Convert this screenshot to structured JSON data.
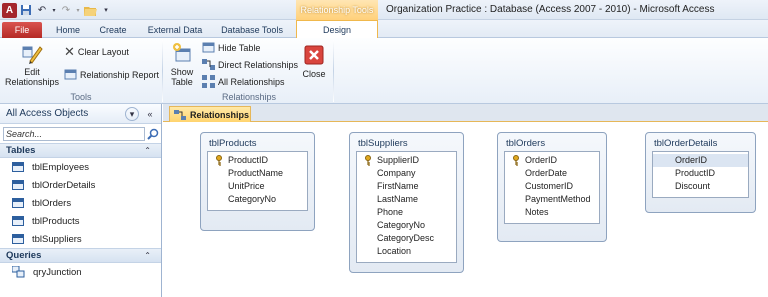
{
  "window": {
    "title": "Organization Practice : Database (Access 2007 - 2010)  -  Microsoft Access",
    "context_tools_label": "Relationship Tools"
  },
  "quick_access": {
    "app_logo": "A",
    "icons": [
      "save-icon",
      "undo-icon",
      "redo-icon",
      "open-folder-icon",
      "customize-dropdown-icon"
    ]
  },
  "tabs": [
    {
      "label": "File"
    },
    {
      "label": "Home"
    },
    {
      "label": "Create"
    },
    {
      "label": "External Data"
    },
    {
      "label": "Database Tools"
    },
    {
      "label": "Design"
    }
  ],
  "ribbon": {
    "edit_relationships": "Edit Relationships",
    "clear_layout": "Clear Layout",
    "relationship_report": "Relationship Report",
    "tools_group": "Tools",
    "show_table": "Show Table",
    "hide_table": "Hide Table",
    "direct_relationships": "Direct Relationships",
    "all_relationships": "All Relationships",
    "close": "Close",
    "relationships_group": "Relationships"
  },
  "nav": {
    "title": "All Access Objects",
    "search_placeholder": "Search...",
    "groups": [
      {
        "label": "Tables",
        "items": [
          "tblEmployees",
          "tblOrderDetails",
          "tblOrders",
          "tblProducts",
          "tblSuppliers"
        ]
      },
      {
        "label": "Queries",
        "items": [
          "qryJunction"
        ]
      }
    ]
  },
  "document": {
    "tab_label": "Relationships",
    "tables": [
      {
        "name": "tblProducts",
        "key": "ProductID",
        "fields": [
          "ProductID",
          "ProductName",
          "UnitPrice",
          "CategoryNo"
        ]
      },
      {
        "name": "tblSuppliers",
        "key": "SupplierID",
        "fields": [
          "SupplierID",
          "Company",
          "FirstName",
          "LastName",
          "Phone",
          "CategoryNo",
          "CategoryDesc",
          "Location"
        ]
      },
      {
        "name": "tblOrders",
        "key": "OrderID",
        "fields": [
          "OrderID",
          "OrderDate",
          "CustomerID",
          "PaymentMethod",
          "Notes"
        ]
      },
      {
        "name": "tblOrderDetails",
        "key": null,
        "selected": "OrderID",
        "fields": [
          "OrderID",
          "ProductID",
          "Discount"
        ]
      }
    ]
  },
  "colors": {
    "file_tab": "#b52a25",
    "context_tab": "#ffd07a",
    "nav_text": "#1e395b"
  }
}
